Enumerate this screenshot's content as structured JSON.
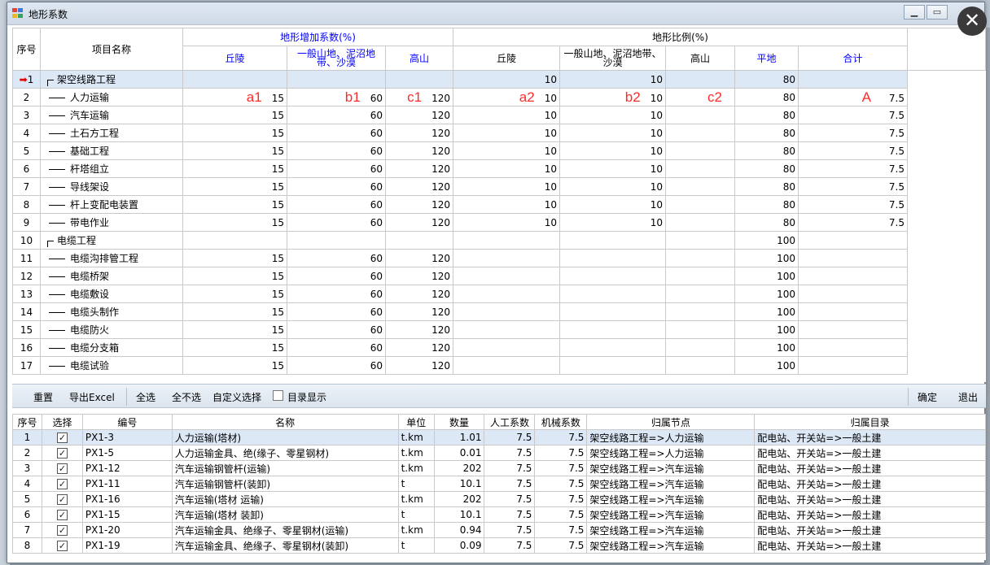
{
  "window": {
    "title": "地形系数"
  },
  "grid": {
    "headers": {
      "seq": "序号",
      "name": "项目名称",
      "group_increase": "地形增加系数(%)",
      "group_ratio": "地形比例(%)",
      "qiuling": "丘陵",
      "shandi": "一般山地、泥沼地带、沙漠",
      "gaoshan": "高山",
      "qiuling2": "丘陵",
      "shandi2": "一般山地、泥沼地带、沙漠",
      "gaoshan2": "高山",
      "pingdi": "平地",
      "heji": "合计"
    },
    "annotations": {
      "a1": "a1",
      "b1": "b1",
      "c1": "c1",
      "a2": "a2",
      "b2": "b2",
      "c2": "c2",
      "A": "A"
    },
    "rows": [
      {
        "seq": "1",
        "name": "架空线路工程",
        "inc1": "",
        "inc2": "",
        "inc3": "",
        "r1": "10",
        "r2": "10",
        "r3": "",
        "flat": "80",
        "total": ""
      },
      {
        "seq": "2",
        "name": "人力运输",
        "inc1": "15",
        "inc2": "60",
        "inc3": "120",
        "r1": "10",
        "r2": "10",
        "r3": "",
        "flat": "80",
        "total": "7.5"
      },
      {
        "seq": "3",
        "name": "汽车运输",
        "inc1": "15",
        "inc2": "60",
        "inc3": "120",
        "r1": "10",
        "r2": "10",
        "r3": "",
        "flat": "80",
        "total": "7.5"
      },
      {
        "seq": "4",
        "name": "土石方工程",
        "inc1": "15",
        "inc2": "60",
        "inc3": "120",
        "r1": "10",
        "r2": "10",
        "r3": "",
        "flat": "80",
        "total": "7.5"
      },
      {
        "seq": "5",
        "name": "基础工程",
        "inc1": "15",
        "inc2": "60",
        "inc3": "120",
        "r1": "10",
        "r2": "10",
        "r3": "",
        "flat": "80",
        "total": "7.5"
      },
      {
        "seq": "6",
        "name": "杆塔组立",
        "inc1": "15",
        "inc2": "60",
        "inc3": "120",
        "r1": "10",
        "r2": "10",
        "r3": "",
        "flat": "80",
        "total": "7.5"
      },
      {
        "seq": "7",
        "name": "导线架设",
        "inc1": "15",
        "inc2": "60",
        "inc3": "120",
        "r1": "10",
        "r2": "10",
        "r3": "",
        "flat": "80",
        "total": "7.5"
      },
      {
        "seq": "8",
        "name": "杆上变配电装置",
        "inc1": "15",
        "inc2": "60",
        "inc3": "120",
        "r1": "10",
        "r2": "10",
        "r3": "",
        "flat": "80",
        "total": "7.5"
      },
      {
        "seq": "9",
        "name": "带电作业",
        "inc1": "15",
        "inc2": "60",
        "inc3": "120",
        "r1": "10",
        "r2": "10",
        "r3": "",
        "flat": "80",
        "total": "7.5"
      },
      {
        "seq": "10",
        "name": "电缆工程",
        "inc1": "",
        "inc2": "",
        "inc3": "",
        "r1": "",
        "r2": "",
        "r3": "",
        "flat": "100",
        "total": ""
      },
      {
        "seq": "11",
        "name": "电缆沟排管工程",
        "inc1": "15",
        "inc2": "60",
        "inc3": "120",
        "r1": "",
        "r2": "",
        "r3": "",
        "flat": "100",
        "total": ""
      },
      {
        "seq": "12",
        "name": "电缆桥架",
        "inc1": "15",
        "inc2": "60",
        "inc3": "120",
        "r1": "",
        "r2": "",
        "r3": "",
        "flat": "100",
        "total": ""
      },
      {
        "seq": "13",
        "name": "电缆敷设",
        "inc1": "15",
        "inc2": "60",
        "inc3": "120",
        "r1": "",
        "r2": "",
        "r3": "",
        "flat": "100",
        "total": ""
      },
      {
        "seq": "14",
        "name": "电缆头制作",
        "inc1": "15",
        "inc2": "60",
        "inc3": "120",
        "r1": "",
        "r2": "",
        "r3": "",
        "flat": "100",
        "total": ""
      },
      {
        "seq": "15",
        "name": "电缆防火",
        "inc1": "15",
        "inc2": "60",
        "inc3": "120",
        "r1": "",
        "r2": "",
        "r3": "",
        "flat": "100",
        "total": ""
      },
      {
        "seq": "16",
        "name": "电缆分支箱",
        "inc1": "15",
        "inc2": "60",
        "inc3": "120",
        "r1": "",
        "r2": "",
        "r3": "",
        "flat": "100",
        "total": ""
      },
      {
        "seq": "17",
        "name": "电缆试验",
        "inc1": "15",
        "inc2": "60",
        "inc3": "120",
        "r1": "",
        "r2": "",
        "r3": "",
        "flat": "100",
        "total": ""
      }
    ]
  },
  "toolbar": {
    "reset": "重置",
    "export": "导出Excel",
    "select_all": "全选",
    "select_none": "全不选",
    "custom": "自定义选择",
    "dir_display": "目录显示",
    "ok": "确定",
    "exit": "退出"
  },
  "detail": {
    "headers": {
      "seq": "序号",
      "select": "选择",
      "code": "编号",
      "name": "名称",
      "unit": "单位",
      "qty": "数量",
      "labor": "人工系数",
      "machine": "机械系数",
      "node": "归属节点",
      "dir": "归属目录"
    },
    "rows": [
      {
        "seq": "1",
        "code": "PX1-3",
        "name": "人力运输(塔材)",
        "unit": "t.km",
        "qty": "1.01",
        "labor": "7.5",
        "machine": "7.5",
        "node": "架空线路工程=>人力运输",
        "dir": "配电站、开关站=>一般土建"
      },
      {
        "seq": "2",
        "code": "PX1-5",
        "name": "人力运输金具、绝(缘子、零星钢材)",
        "unit": "t.km",
        "qty": "0.01",
        "labor": "7.5",
        "machine": "7.5",
        "node": "架空线路工程=>人力运输",
        "dir": "配电站、开关站=>一般土建"
      },
      {
        "seq": "3",
        "code": "PX1-12",
        "name": "汽车运输钢管杆(运输)",
        "unit": "t.km",
        "qty": "202",
        "labor": "7.5",
        "machine": "7.5",
        "node": "架空线路工程=>汽车运输",
        "dir": "配电站、开关站=>一般土建"
      },
      {
        "seq": "4",
        "code": "PX1-11",
        "name": "汽车运输钢管杆(装卸)",
        "unit": "t",
        "qty": "10.1",
        "labor": "7.5",
        "machine": "7.5",
        "node": "架空线路工程=>汽车运输",
        "dir": "配电站、开关站=>一般土建"
      },
      {
        "seq": "5",
        "code": "PX1-16",
        "name": "汽车运输(塔材 运输)",
        "unit": "t.km",
        "qty": "202",
        "labor": "7.5",
        "machine": "7.5",
        "node": "架空线路工程=>汽车运输",
        "dir": "配电站、开关站=>一般土建"
      },
      {
        "seq": "6",
        "code": "PX1-15",
        "name": "汽车运输(塔材 装卸)",
        "unit": "t",
        "qty": "10.1",
        "labor": "7.5",
        "machine": "7.5",
        "node": "架空线路工程=>汽车运输",
        "dir": "配电站、开关站=>一般土建"
      },
      {
        "seq": "7",
        "code": "PX1-20",
        "name": "汽车运输金具、绝缘子、零星钢材(运输)",
        "unit": "t.km",
        "qty": "0.94",
        "labor": "7.5",
        "machine": "7.5",
        "node": "架空线路工程=>汽车运输",
        "dir": "配电站、开关站=>一般土建"
      },
      {
        "seq": "8",
        "code": "PX1-19",
        "name": "汽车运输金具、绝缘子、零星钢材(装卸)",
        "unit": "t",
        "qty": "0.09",
        "labor": "7.5",
        "machine": "7.5",
        "node": "架空线路工程=>汽车运输",
        "dir": "配电站、开关站=>一般土建"
      }
    ]
  }
}
